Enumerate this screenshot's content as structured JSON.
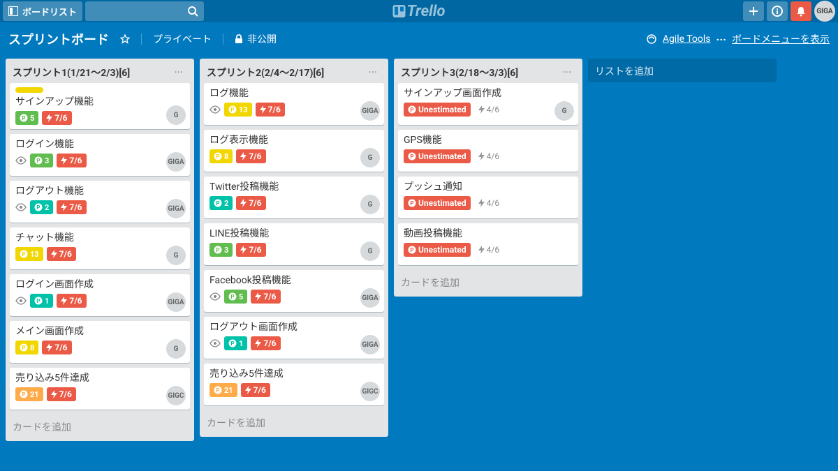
{
  "topbar": {
    "boards_label": "ボードリスト",
    "logo_text": "Trello",
    "avatar": "GIGA"
  },
  "board_header": {
    "title": "スプリントボード",
    "visibility": "プライベート",
    "privacy": "非公開",
    "agile_tools": "Agile Tools",
    "show_menu": "ボードメニューを表示"
  },
  "point_colors": {
    "green": "#61bd4f",
    "yellow": "#f2d600",
    "orange": "#ffab4a",
    "red": "#eb5a46",
    "teal": "#00c2a8"
  },
  "lists": [
    {
      "title": "スプリント1(1/21～2/3)[6]",
      "cards": [
        {
          "title": "サインアップ機能",
          "stripe": "#f2d600",
          "watch": false,
          "point": "5",
          "point_color": "green",
          "burn": "7/6",
          "avatar": "G"
        },
        {
          "title": "ログイン機能",
          "watch": true,
          "point": "3",
          "point_color": "green",
          "burn": "7/6",
          "avatar": "GIGA"
        },
        {
          "title": "ログアウト機能",
          "watch": true,
          "point": "2",
          "point_color": "teal",
          "burn": "7/6",
          "avatar": "GIGA"
        },
        {
          "title": "チャット機能",
          "watch": false,
          "point": "13",
          "point_color": "yellow",
          "burn": "7/6",
          "avatar": "G"
        },
        {
          "title": "ログイン画面作成",
          "watch": true,
          "point": "1",
          "point_color": "teal",
          "burn": "7/6",
          "avatar": "GIGA"
        },
        {
          "title": "メイン画面作成",
          "watch": false,
          "point": "8",
          "point_color": "yellow",
          "burn": "7/6",
          "avatar": "G"
        },
        {
          "title": "売り込み5件達成",
          "watch": false,
          "point": "21",
          "point_color": "orange",
          "burn": "7/6",
          "avatar": "GIGC"
        }
      ],
      "add_card": "カードを追加"
    },
    {
      "title": "スプリント2(2/4～2/17)[6]",
      "cards": [
        {
          "title": "ログ機能",
          "watch": true,
          "point": "13",
          "point_color": "yellow",
          "burn": "7/6",
          "avatar": "GIGA"
        },
        {
          "title": "ログ表示機能",
          "watch": false,
          "point": "8",
          "point_color": "yellow",
          "burn": "7/6",
          "avatar": "G"
        },
        {
          "title": "Twitter投稿機能",
          "watch": false,
          "point": "2",
          "point_color": "teal",
          "burn": "7/6",
          "avatar": "G"
        },
        {
          "title": "LINE投稿機能",
          "watch": false,
          "point": "3",
          "point_color": "green",
          "burn": "7/6",
          "avatar": "G"
        },
        {
          "title": "Facebook投稿機能",
          "watch": true,
          "point": "5",
          "point_color": "green",
          "burn": "7/6",
          "avatar": "GIGA"
        },
        {
          "title": "ログアウト画面作成",
          "watch": true,
          "point": "1",
          "point_color": "teal",
          "burn": "7/6",
          "avatar": "GIGA"
        },
        {
          "title": "売り込み5件達成",
          "watch": false,
          "point": "21",
          "point_color": "orange",
          "burn": "7/6",
          "avatar": "GIGC"
        }
      ],
      "add_card": "カードを追加"
    },
    {
      "title": "スプリント3(2/18～3/3)[6]",
      "cards": [
        {
          "title": "サインアップ画面作成",
          "unestimated": "Unestimated",
          "grey_burn": "4/6",
          "avatar": "G"
        },
        {
          "title": "GPS機能",
          "unestimated": "Unestimated",
          "grey_burn": "4/6"
        },
        {
          "title": "プッシュ通知",
          "unestimated": "Unestimated",
          "grey_burn": "4/6"
        },
        {
          "title": "動画投稿機能",
          "unestimated": "Unestimated",
          "grey_burn": "4/6"
        }
      ],
      "add_card": "カードを追加"
    }
  ],
  "add_list": "リストを追加"
}
